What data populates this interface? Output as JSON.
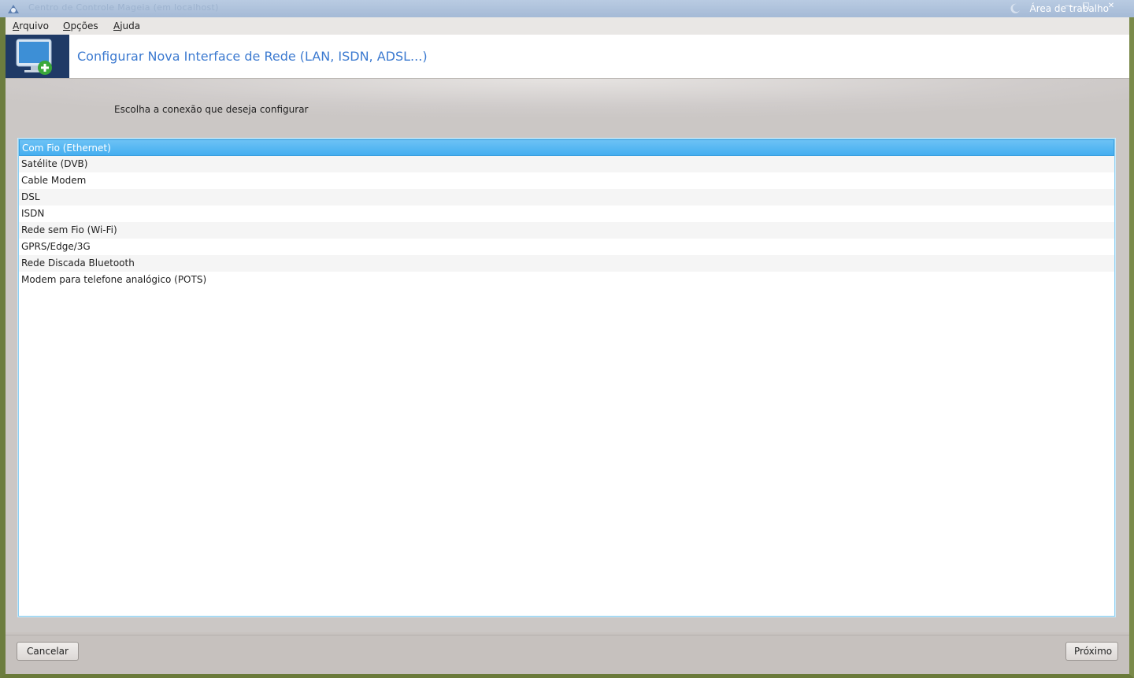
{
  "window": {
    "title": "Centro de Controle Mageia (em localhost)",
    "desktop_label": "Área de trabalho"
  },
  "menubar": {
    "items": [
      {
        "label": "Arquivo",
        "mnemonic": "A",
        "rest": "rquivo"
      },
      {
        "label": "Opções",
        "mnemonic": "O",
        "rest": "pções"
      },
      {
        "label": "Ajuda",
        "mnemonic": "A",
        "rest": "juda"
      }
    ]
  },
  "header": {
    "title": "Configurar Nova Interface de Rede (LAN, ISDN, ADSL...)",
    "icon": "monitor-add-icon"
  },
  "main": {
    "prompt": "Escolha a conexão que deseja configurar",
    "connection_types": [
      "Com Fio (Ethernet)",
      "Satélite (DVB)",
      "Cable Modem",
      "DSL",
      "ISDN",
      "Rede sem Fio (Wi-Fi)",
      "GPRS/Edge/3G",
      "Rede Discada Bluetooth",
      "Modem para telefone analógico (POTS)"
    ],
    "selected_index": 0
  },
  "footer": {
    "cancel_label": "Cancelar",
    "next_label": "Próximo"
  },
  "colors": {
    "accent": "#45aef0",
    "heading": "#3c7ad0",
    "logo_bg": "#1f3a66"
  }
}
